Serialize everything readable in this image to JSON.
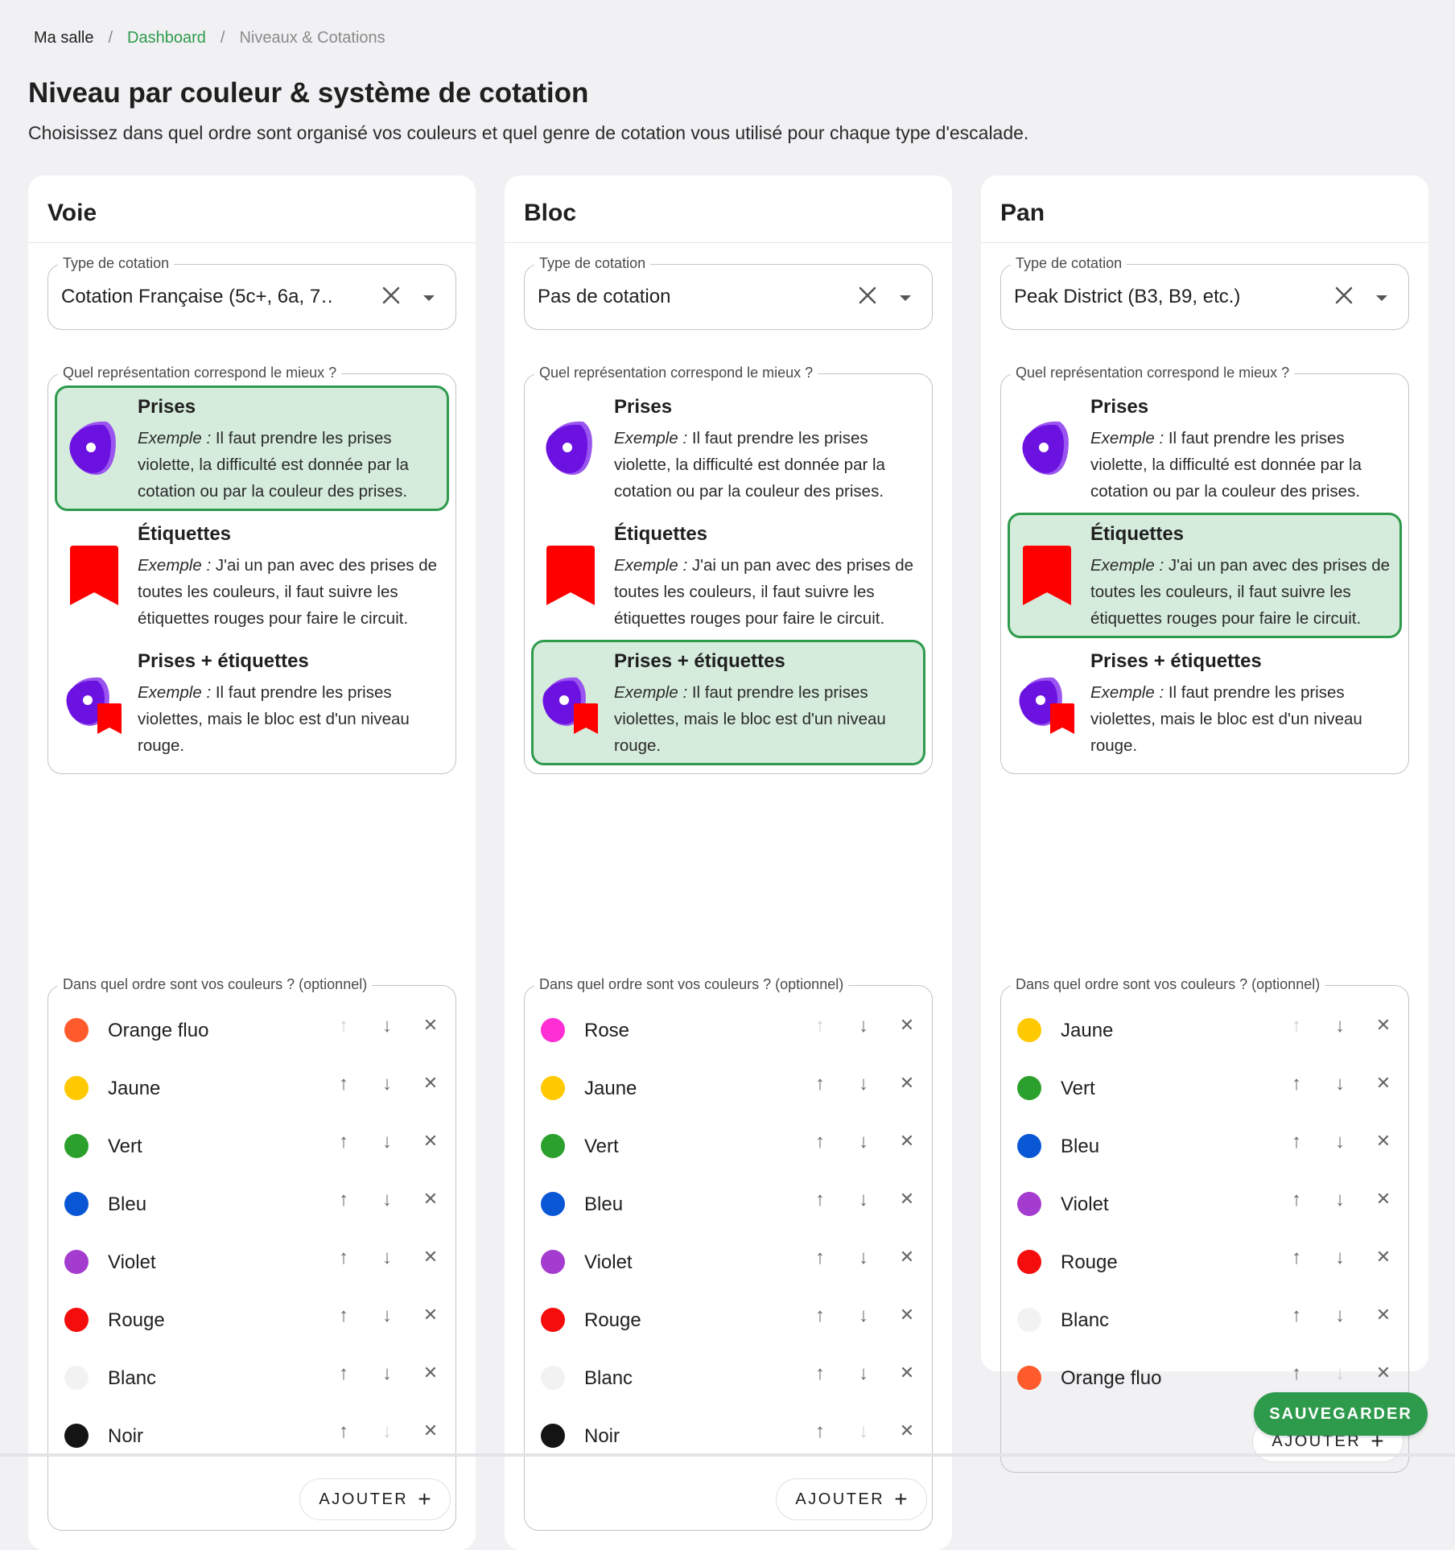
{
  "breadcrumb": {
    "home": "Ma salle",
    "separator": "/",
    "dashboard": "Dashboard",
    "current": "Niveaux & Cotations"
  },
  "page": {
    "title": "Niveau par couleur & système de cotation",
    "subtitle": "Choisissez dans quel ordre sont organisé vos couleurs et quel genre de cotation vous utilisé pour chaque type d'escalade."
  },
  "labels": {
    "grading_type": "Type de cotation",
    "representation_question": "Quel représentation correspond le mieux ?",
    "order_question": "Dans quel ordre sont vos couleurs ? (optionnel)",
    "example_prefix": "Exemple :",
    "add_button": "AJOUTER",
    "add_icon": "+",
    "up_icon": "↑",
    "down_icon": "↓",
    "delete_icon": "✕",
    "clear_icon": "✕"
  },
  "representations": [
    {
      "key": "holds",
      "title": "Prises",
      "desc": "Il faut prendre les prises violette, la difficulté est donnée par la cotation ou par la couleur des prises.",
      "icon": "hold-icon"
    },
    {
      "key": "tags",
      "title": "Étiquettes",
      "desc": "J'ai un pan avec des prises de toutes les couleurs, il faut suivre les étiquettes rouges pour faire le circuit.",
      "icon": "tag-icon"
    },
    {
      "key": "both",
      "title": "Prises + étiquettes",
      "desc": "Il faut prendre les prises violettes, mais le bloc est d'un niveau rouge.",
      "icon": "hold-tag-icon"
    }
  ],
  "cards": [
    {
      "title": "Voie",
      "grading_value": "Cotation Française (5c+, 6a, 7…",
      "selected_representation": "holds",
      "colors": [
        {
          "name": "Orange fluo",
          "hex": "#ff5a2b"
        },
        {
          "name": "Jaune",
          "hex": "#ffc900"
        },
        {
          "name": "Vert",
          "hex": "#2ca02c"
        },
        {
          "name": "Bleu",
          "hex": "#0a57d6"
        },
        {
          "name": "Violet",
          "hex": "#a43ccf"
        },
        {
          "name": "Rouge",
          "hex": "#f50c0c"
        },
        {
          "name": "Blanc",
          "hex": "#f2f2f2"
        },
        {
          "name": "Noir",
          "hex": "#141414"
        }
      ]
    },
    {
      "title": "Bloc",
      "grading_value": "Pas de cotation",
      "selected_representation": "both",
      "colors": [
        {
          "name": "Rose",
          "hex": "#ff2ed5"
        },
        {
          "name": "Jaune",
          "hex": "#ffc900"
        },
        {
          "name": "Vert",
          "hex": "#2ca02c"
        },
        {
          "name": "Bleu",
          "hex": "#0a57d6"
        },
        {
          "name": "Violet",
          "hex": "#a43ccf"
        },
        {
          "name": "Rouge",
          "hex": "#f50c0c"
        },
        {
          "name": "Blanc",
          "hex": "#f2f2f2"
        },
        {
          "name": "Noir",
          "hex": "#141414"
        }
      ]
    },
    {
      "title": "Pan",
      "grading_value": "Peak District (B3, B9, etc.)",
      "selected_representation": "tags",
      "colors": [
        {
          "name": "Jaune",
          "hex": "#ffc900"
        },
        {
          "name": "Vert",
          "hex": "#2ca02c"
        },
        {
          "name": "Bleu",
          "hex": "#0a57d6"
        },
        {
          "name": "Violet",
          "hex": "#a43ccf"
        },
        {
          "name": "Rouge",
          "hex": "#f50c0c"
        },
        {
          "name": "Blanc",
          "hex": "#f2f2f2"
        },
        {
          "name": "Orange fluo",
          "hex": "#ff5a2b"
        }
      ]
    }
  ],
  "save_button": "SAUVEGARDER",
  "theme": {
    "accent": "#2e9a4c",
    "selected_bg": "#d5ebdc",
    "hold_color": "#6b12e0",
    "tag_color": "#ff0000"
  }
}
